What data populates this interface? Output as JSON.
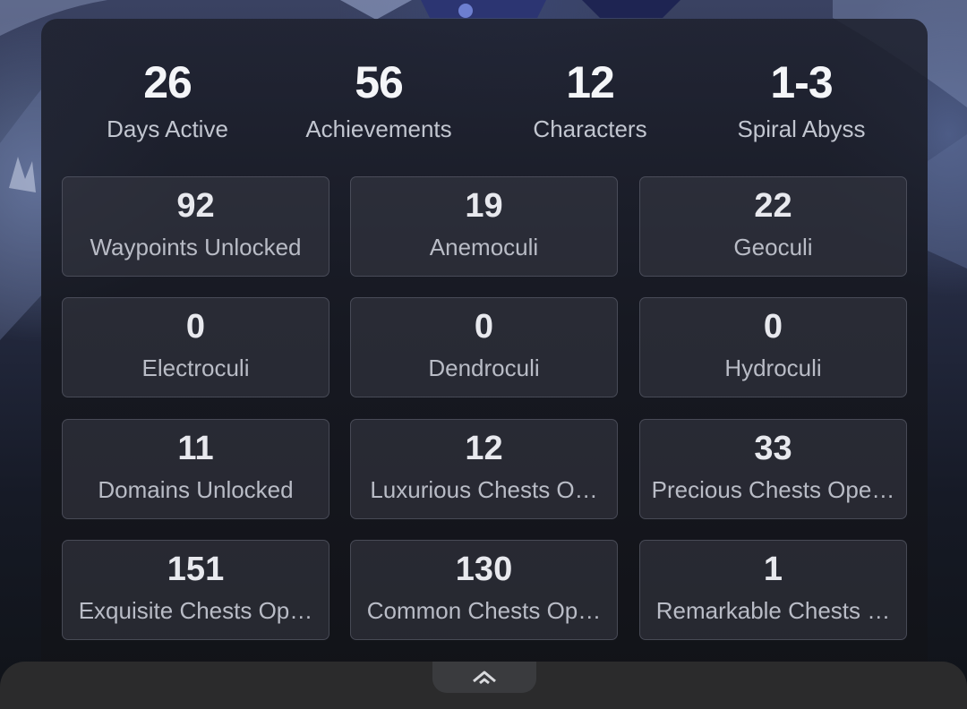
{
  "summary": [
    {
      "value": "26",
      "label": "Days Active"
    },
    {
      "value": "56",
      "label": "Achievements"
    },
    {
      "value": "12",
      "label": "Characters"
    },
    {
      "value": "1-3",
      "label": "Spiral Abyss"
    }
  ],
  "stats": [
    {
      "value": "92",
      "label": "Waypoints Unlocked"
    },
    {
      "value": "19",
      "label": "Anemoculi"
    },
    {
      "value": "22",
      "label": "Geoculi"
    },
    {
      "value": "0",
      "label": "Electroculi"
    },
    {
      "value": "0",
      "label": "Dendroculi"
    },
    {
      "value": "0",
      "label": "Hydroculi"
    },
    {
      "value": "11",
      "label": "Domains Unlocked"
    },
    {
      "value": "12",
      "label": "Luxurious Chests O…"
    },
    {
      "value": "33",
      "label": "Precious Chests Ope…"
    },
    {
      "value": "151",
      "label": "Exquisite Chests Op…"
    },
    {
      "value": "130",
      "label": "Common Chests Op…"
    },
    {
      "value": "1",
      "label": "Remarkable Chests …"
    }
  ],
  "icons": {
    "collapse": "chevron-up-icon"
  },
  "colors": {
    "panel": "#16181f",
    "value_text": "#f4f5f8",
    "label_text": "#c2c6d0",
    "bottom_bar": "#2b2b2c"
  }
}
